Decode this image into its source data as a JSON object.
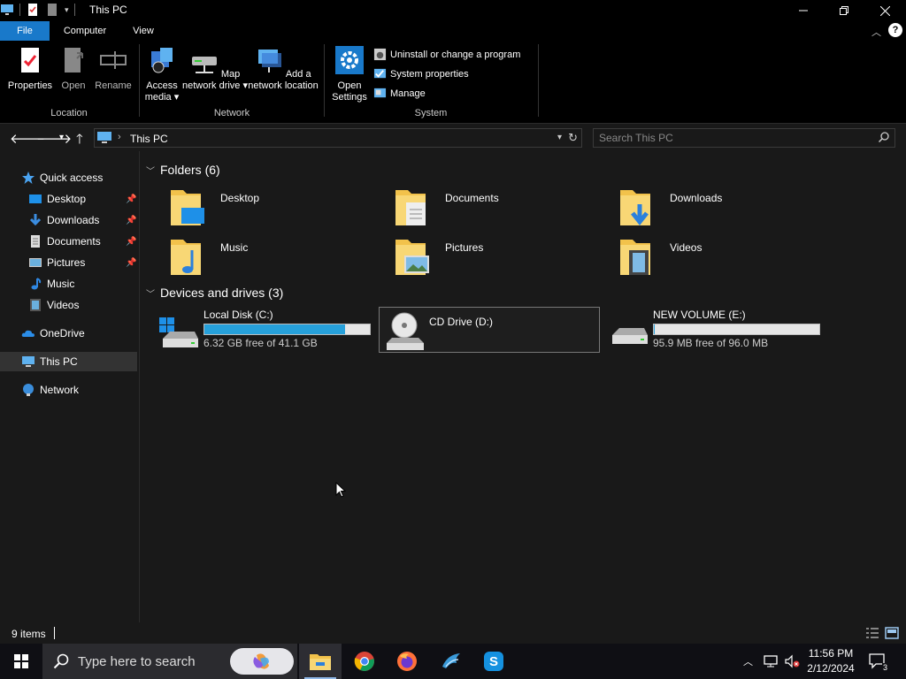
{
  "window": {
    "title": "This PC"
  },
  "ribbon": {
    "tabs": [
      {
        "label": "File"
      },
      {
        "label": "Computer"
      },
      {
        "label": "View"
      }
    ],
    "location": {
      "label": "Location",
      "properties": "Properties",
      "open": "Open",
      "rename": "Rename"
    },
    "network": {
      "label": "Network",
      "access_media": "Access media",
      "map_network_drive": "Map network drive",
      "add_network_location": "Add a network location"
    },
    "system": {
      "label": "System",
      "open_settings": "Open Settings",
      "uninstall": "Uninstall or change a program",
      "system_properties": "System properties",
      "manage": "Manage"
    }
  },
  "address": {
    "breadcrumb": "This PC",
    "search_placeholder": "Search This PC"
  },
  "nav": {
    "quick_access": "Quick access",
    "pinned": [
      {
        "label": "Desktop",
        "pinned": true
      },
      {
        "label": "Downloads",
        "pinned": true
      },
      {
        "label": "Documents",
        "pinned": true
      },
      {
        "label": "Pictures",
        "pinned": true
      },
      {
        "label": "Music",
        "pinned": false
      },
      {
        "label": "Videos",
        "pinned": false
      }
    ],
    "onedrive": "OneDrive",
    "this_pc": "This PC",
    "network": "Network"
  },
  "folders": {
    "header": "Folders (6)",
    "items": [
      {
        "name": "Desktop"
      },
      {
        "name": "Documents"
      },
      {
        "name": "Downloads"
      },
      {
        "name": "Music"
      },
      {
        "name": "Pictures"
      },
      {
        "name": "Videos"
      }
    ]
  },
  "drives": {
    "header": "Devices and drives (3)",
    "items": [
      {
        "name": "Local Disk (C:)",
        "free_text": "6.32 GB free of 41.1 GB",
        "used_fraction": 0.85
      },
      {
        "name": "CD Drive (D:)",
        "free_text": "",
        "used_fraction": null
      },
      {
        "name": "NEW VOLUME (E:)",
        "free_text": "95.9 MB free of 96.0 MB",
        "used_fraction": 0.001
      }
    ]
  },
  "status": {
    "count": "9 items"
  },
  "taskbar": {
    "search_placeholder": "Type here to search",
    "time": "11:56 PM",
    "date": "2/12/2024",
    "notification_count": "3"
  },
  "colors": {
    "accent": "#1979ca",
    "drive_bar": "#26a0da",
    "folder": "#f2c24b"
  }
}
